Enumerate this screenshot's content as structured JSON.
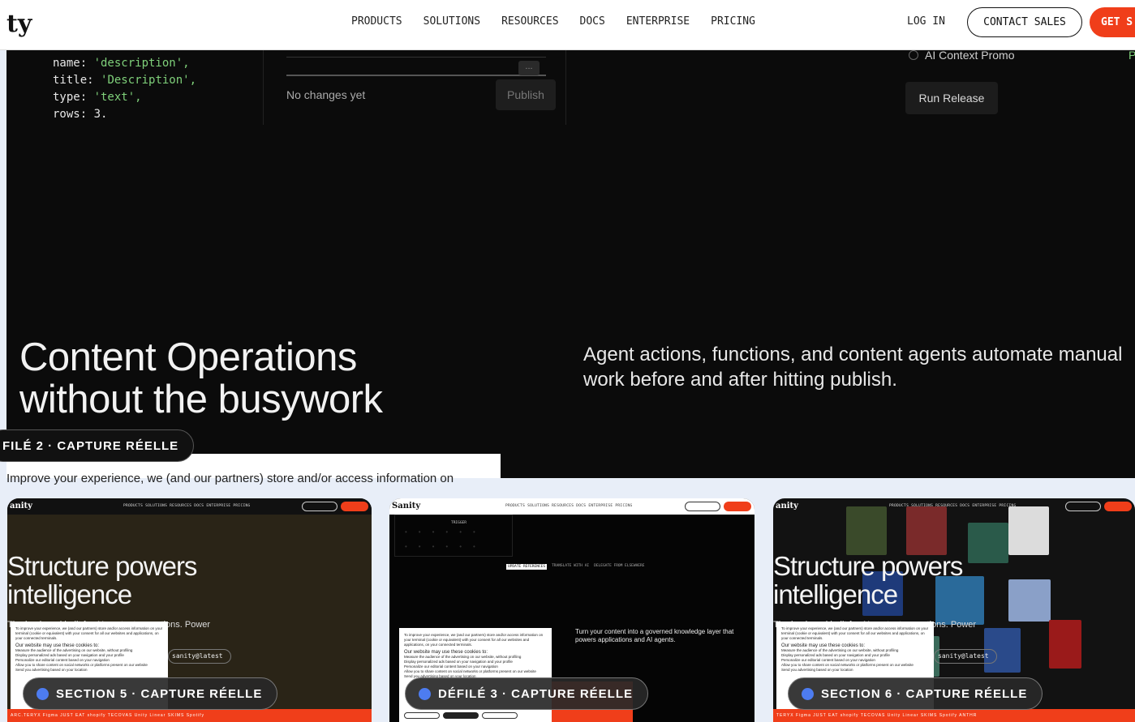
{
  "nav": {
    "logo": "ty",
    "links": [
      "PRODUCTS",
      "SOLUTIONS",
      "RESOURCES",
      "DOCS",
      "ENTERPRISE",
      "PRICING"
    ],
    "login": "LOG IN",
    "contact": "CONTACT SALES",
    "get_started": "GET S"
  },
  "editor": {
    "code_lines": [
      {
        "key": "name: ",
        "val": "'description',"
      },
      {
        "key": "title: ",
        "val": "'Description',"
      },
      {
        "key": "type: ",
        "val": "'text',"
      },
      {
        "key": "rows: ",
        "val": "3."
      }
    ],
    "no_changes": "No changes yet",
    "publish": "Publish",
    "dots": "...",
    "promo": "AI Context Promo",
    "promo_status": "Po",
    "run_release": "Run Release"
  },
  "hero": {
    "headline_1": "Content Operations",
    "headline_2": "without the busywork",
    "tagline": "Agent actions, functions, and content agents automate manual work before and after hitting publish.",
    "badge": "FILÉ 2 · CAPTURE RÉELLE",
    "cookie_text": "Improve your experience, we (and our partners) store and/or access information on"
  },
  "thumbs": [
    {
      "logo": "anity",
      "links": "PRODUCTS  SOLUTIONS  RESOURCES  DOCS  ENTERPRISE  PRICING",
      "head_1": "Structure powers",
      "head_2": "intelligence",
      "sub": "The back-end built for AI content operations. Power",
      "sub2": "cale.",
      "pill": "sanity@latest",
      "badge": "SECTION 5 · CAPTURE RÉELLE",
      "logos": "ARC.TERYX   Figma   JUST EAT   shopify   TECOVAS   Unity   Linear   SKIMS   Spotify"
    },
    {
      "logo": "Sanity",
      "links": "PRODUCTS  SOLUTIONS  RESOURCES  DOCS  ENTERPRISE  PRICING",
      "trigger": "TRIGGER",
      "tabs": [
        "UPDATE REFERENCES",
        "TRANSLATE WITH AI",
        "DELEGATE FROM ELSEWHERE"
      ],
      "text": "Turn your content into a governed knowledge layer that powers applications and AI agents.",
      "badge": "DÉFILÉ 3 · CAPTURE RÉELLE"
    },
    {
      "logo": "anity",
      "links": "PRODUCTS  SOLUTIONS  RESOURCES  DOCS  ENTERPRISE  PRICING",
      "head_1": "Structure powers",
      "head_2": "intelligence",
      "sub": "The back-end built for AI content operations. Power",
      "sub2": "cale.",
      "pill": "sanity@latest",
      "badge": "SECTION 6 · CAPTURE RÉELLE",
      "logos": "TERYX   Figma   JUST EAT   shopify   TECOVAS   Unity   Linear   SKIMS   Spotify   ANTHR"
    }
  ],
  "cookie_small": {
    "intro": "To improve your experience, we (and our partners) store and/or access information on your terminal (cookie or equivalent) with your consent for all our websites and applications, on your connected terminals.",
    "uses_title": "Our website may use these cookies to:",
    "uses": [
      "Measure the audience of the advertising on our website, without profiling",
      "Display personalized ads based on your navigation and your profile",
      "Personalize our editorial content based on your navigation",
      "Allow you to share content on social networks or platforms present on our website",
      "Send you advertising based on your location"
    ]
  }
}
